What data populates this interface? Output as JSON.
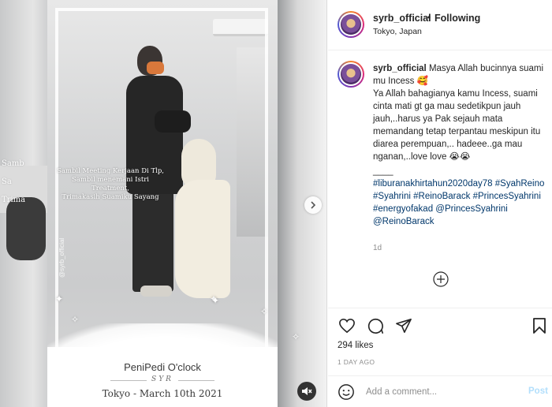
{
  "post": {
    "username": "syrb_official",
    "separator": "•",
    "follow_status": "Following",
    "location": "Tokyo, Japan"
  },
  "media": {
    "overlay_caption": "Sambil Meeting Kerjaan Di Tlp,\nSambil menemani Istri Treatment,\nTrimakasih Suamiku Sayang",
    "side_caption": "Samb\nSa\nTrima",
    "watermark": "@syrb_official",
    "card_title": "PeniPedi O'clock",
    "card_signature": "SYR",
    "card_date": "Tokyo - March 10th 2021",
    "icons": {
      "next": "chevron-right-icon",
      "sound": "speaker-muted-icon"
    }
  },
  "caption": {
    "username": "syrb_official",
    "line1": "Masya Allah bucinnya suami mu Incess 🥰",
    "line2": "Ya Allah bahagianya kamu Incess, suami cinta mati gt ga mau sedetikpun jauh jauh,..harus ya Pak sejauh mata memandang tetap terpantau meskipun itu diarea perempuan,.. hadeee..ga mau nganan,..love love 😭😭",
    "divider": "____",
    "hashtags": [
      "#liburanakhirtahun2020day78",
      "#SyahReino",
      "#Syahrini",
      "#ReinoBarack",
      "#PrincesSyahrini",
      "#energyofakad"
    ],
    "mentions": [
      "@PrincesSyahrini",
      "@ReinoBarack"
    ],
    "time_ago": "1d"
  },
  "actions": {
    "icons": [
      "heart-icon",
      "comment-icon",
      "share-icon",
      "bookmark-icon"
    ],
    "likes": "294 likes",
    "date": "1 DAY AGO"
  },
  "comment_box": {
    "placeholder": "Add a comment...",
    "post_label": "Post"
  }
}
